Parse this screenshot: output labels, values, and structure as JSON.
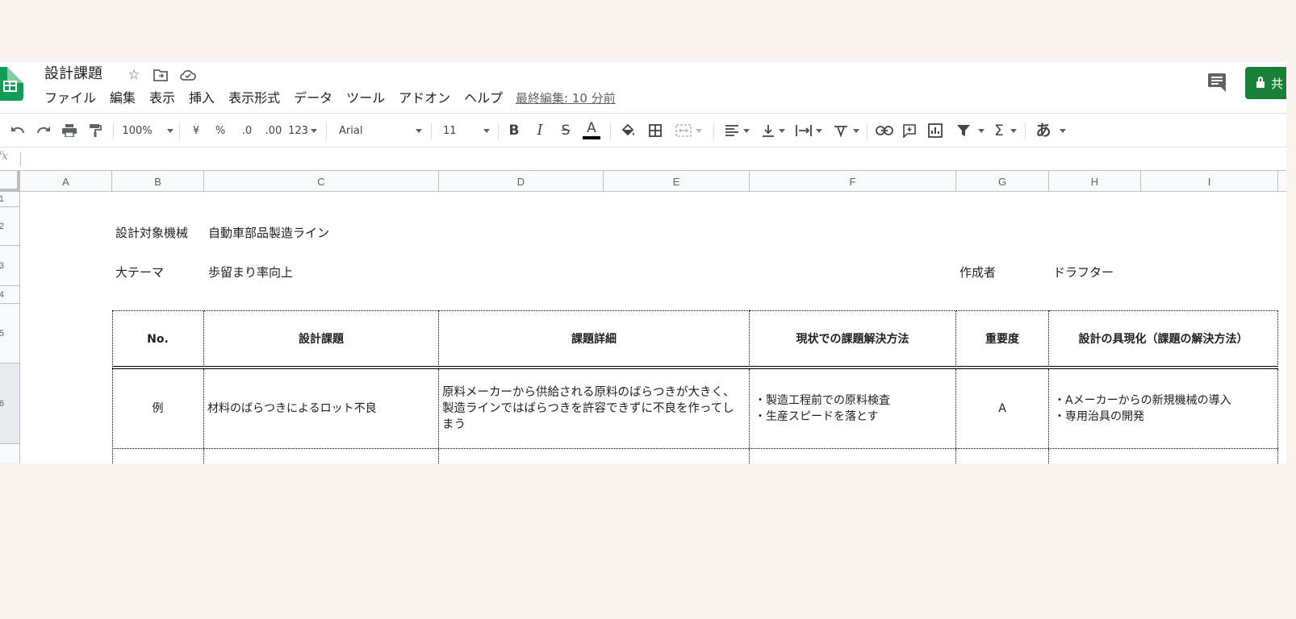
{
  "doc": {
    "title": "設計課題",
    "last_edit": "最終編集: 10 分前"
  },
  "menu": [
    "ファイル",
    "編集",
    "表示",
    "挿入",
    "表示形式",
    "データ",
    "ツール",
    "アドオン",
    "ヘルプ"
  ],
  "share": {
    "label": "共"
  },
  "toolbar": {
    "zoom": "100%",
    "currency": "¥",
    "percent": "%",
    "decimal_decrease": ".0",
    "decimal_increase": ".00",
    "more_formats": "123",
    "font": "Arial",
    "font_size": "11",
    "bold": "B",
    "italic": "I",
    "strike": "S",
    "text_color": "A",
    "input_tools": "あ"
  },
  "formula_bar": {
    "fx": "fx",
    "value": ""
  },
  "columns": [
    "A",
    "B",
    "C",
    "D",
    "E",
    "F",
    "G",
    "H",
    "I"
  ],
  "rows": [
    "1",
    "2",
    "3",
    "4",
    "5",
    "6"
  ],
  "sheet": {
    "b2": "設計対象機械",
    "c2": "自動車部品製造ライン",
    "b3": "大テーマ",
    "c3": "歩留まり率向上",
    "g3": "作成者",
    "h3": "ドラフター"
  },
  "table": {
    "headers": [
      "No.",
      "設計課題",
      "課題詳細",
      "現状での課題解決方法",
      "重要度",
      "設計の具現化（課題の解決方法）"
    ],
    "rows": [
      [
        "例",
        "材料のばらつきによるロット不良",
        "原料メーカーから供給される原料のばらつきが大きく、製造ラインではばらつきを許容できずに不良を作ってしまう",
        "・製造工程前での原料検査\n・生産スピードを落とす",
        "A",
        "・Aメーカーからの新規機械の導入\n・専用治具の開発"
      ]
    ]
  },
  "colors": {
    "sheets_green": "#0f9d58",
    "share_green": "#188038",
    "page_bg": "#f9f4ef"
  }
}
